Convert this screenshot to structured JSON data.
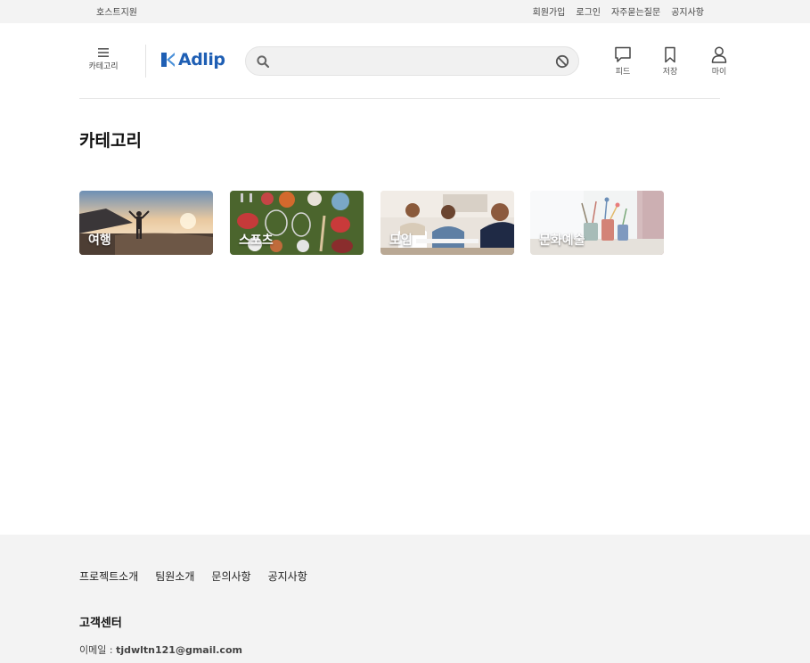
{
  "topbar": {
    "host_support": "호스트지원",
    "links": [
      "회원가입",
      "로그인",
      "자주묻는질문",
      "공지사항"
    ]
  },
  "header": {
    "category_label": "카테고리",
    "logo_text": "Adlip",
    "search_placeholder": "",
    "search_value": "",
    "icons": [
      {
        "name": "feed",
        "label": "피드",
        "icon": "speech-bubble-icon"
      },
      {
        "name": "saved",
        "label": "저장",
        "icon": "bookmark-icon"
      },
      {
        "name": "my",
        "label": "마이",
        "icon": "user-icon"
      }
    ]
  },
  "main": {
    "title": "카테고리",
    "categories": [
      {
        "label": "여행"
      },
      {
        "label": "스포츠"
      },
      {
        "label": "모임"
      },
      {
        "label": "문화예술"
      }
    ]
  },
  "footer": {
    "links": [
      "프로젝트소개",
      "팀원소개",
      "문의사항",
      "공지사항"
    ],
    "cs_title": "고객센터",
    "email_label": "이메일 : ",
    "email_value": "tjdwltn121@gmail.com"
  },
  "colors": {
    "brand": "#1f5fb4",
    "topbar_bg": "#f3f3f3",
    "footer_bg": "#f3f3f3"
  }
}
